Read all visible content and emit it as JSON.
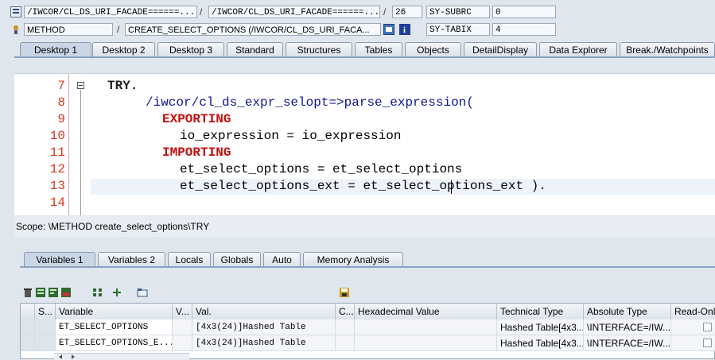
{
  "header": {
    "row1": {
      "program": "/IWCOR/CL_DS_URI_FACADE======...",
      "include": "/IWCOR/CL_DS_URI_FACADE======...",
      "line": "26",
      "sysfield_name": "SY-SUBRC",
      "sysfield_value": "0"
    },
    "row2": {
      "event_type": "METHOD",
      "event_name": "CREATE_SELECT_OPTIONS (/IWCOR/CL_DS_URI_FACA...",
      "sysfield_name": "SY-TABIX",
      "sysfield_value": "4"
    },
    "slash": "/"
  },
  "tabs": [
    "Desktop 1",
    "Desktop 2",
    "Desktop 3",
    "Standard",
    "Structures",
    "Tables",
    "Objects",
    "DetailDisplay",
    "Data Explorer",
    "Break./Watchpoints"
  ],
  "active_tab": "Desktop 1",
  "code": {
    "lines": [
      {
        "num": "7",
        "text": "TRY."
      },
      {
        "num": "8",
        "text": "/iwcor/cl_ds_expr_selopt=>parse_expression("
      },
      {
        "num": "9",
        "text": "EXPORTING"
      },
      {
        "num": "10",
        "text": "io_expression = io_expression"
      },
      {
        "num": "11",
        "text": "IMPORTING"
      },
      {
        "num": "12",
        "text": "et_select_options = et_select_options"
      },
      {
        "num": "13",
        "text": "et_select_options_ext = et_select_options_ext )."
      },
      {
        "num": "14",
        "text": ""
      }
    ]
  },
  "scope_text": "Scope: \\METHOD create_select_options\\TRY",
  "subtabs": [
    "Variables 1",
    "Variables 2",
    "Locals",
    "Globals",
    "Auto",
    "Memory Analysis"
  ],
  "active_subtab": "Variables 1",
  "grid": {
    "headers": [
      "S...",
      "Variable",
      "V...",
      "Val.",
      "C...",
      "Hexadecimal Value",
      "Technical Type",
      "Absolute Type",
      "Read-Only"
    ],
    "rows": [
      {
        "variable": "ET_SELECT_OPTIONS",
        "value": "[4x3(24)]Hashed Table",
        "technical_type": "Hashed Table[4x3...",
        "absolute_type": "\\INTERFACE=/IW..."
      },
      {
        "variable": "ET_SELECT_OPTIONS_E...",
        "value": "[4x3(24)]Hashed Table",
        "technical_type": "Hashed Table[4x3...",
        "absolute_type": "\\INTERFACE=/IW..."
      }
    ]
  },
  "icons": {
    "row1": "program-icon",
    "row2": "method-icon",
    "toolbar": [
      "delete-icon",
      "list-icon",
      "list-icon-2",
      "list-icon-3",
      "tree-icon",
      "expand-icon",
      "folder-icon",
      "save-icon"
    ]
  },
  "colors": {
    "keyword": "#7f0000",
    "line_numbers": "#d2381e",
    "class_ref": "#0c1593"
  }
}
